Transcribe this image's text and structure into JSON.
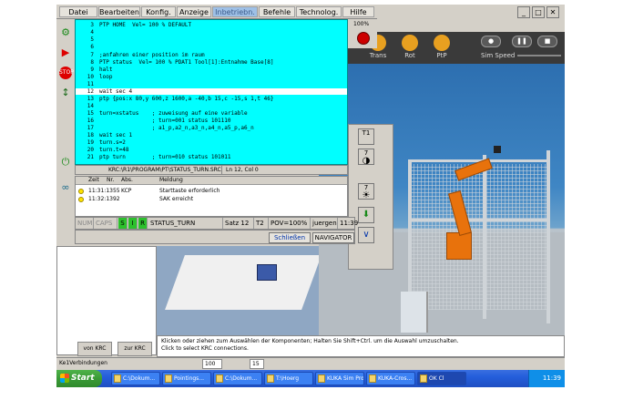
{
  "menu": [
    "Datei",
    "Bearbeiten",
    "Konfig.",
    "Anzeige",
    "Inbetriebn.",
    "Befehle",
    "Technolog.",
    "Hilfe"
  ],
  "window_controls": [
    "_",
    "□",
    "✕"
  ],
  "right_top": {
    "zoom": "100%"
  },
  "sim_toolbar": {
    "buttons": [
      "Trans",
      "Rot",
      "PtP"
    ],
    "speed_label": "Sim Speed"
  },
  "editor": {
    "lines": [
      {
        "num": "3",
        "code": "PTP HOME  Vel= 100 % DEFAULT"
      },
      {
        "num": "4",
        "code": ""
      },
      {
        "num": "5",
        "code": ""
      },
      {
        "num": "6",
        "code": ""
      },
      {
        "num": "7",
        "code": ";anfahren einer position im raum"
      },
      {
        "num": "8",
        "code": "PTP status  Vel= 100 % PDAT1 Tool[1]:Entnahme Base[8]"
      },
      {
        "num": "9",
        "code": "halt"
      },
      {
        "num": "10",
        "code": "loop"
      },
      {
        "num": "11",
        "code": ""
      },
      {
        "num": "12",
        "code": "wait sec 4"
      },
      {
        "num": "13",
        "code": "ptp {pos:x 80,y 600,z 1600,a -40,b 15,c -15,s 1,t 46}"
      },
      {
        "num": "14",
        "code": ""
      },
      {
        "num": "15",
        "code": "turn=xstatus    ; zuweisung auf eine variable"
      },
      {
        "num": "16",
        "code": "                ; turn=001 status 101110"
      },
      {
        "num": "17",
        "code": "                ; a1_p,a2_n,a3_n,a4_n,a5_p,a6_n"
      },
      {
        "num": "18",
        "code": "wait sec 1"
      },
      {
        "num": "19",
        "code": "turn.s=2"
      },
      {
        "num": "20",
        "code": "turn.t=48"
      },
      {
        "num": "21",
        "code": "ptp turn        ; turn=010 status 101011"
      }
    ],
    "path": "KRC:\\R1\\PROGRAM\\PT\\STATUS_TURN.SRC",
    "cursor_pos": "Ln 12, Col 0"
  },
  "messages": {
    "headers": [
      "Zeit",
      "Nr.",
      "Abs.",
      "Meldung"
    ],
    "rows": [
      {
        "time": "11:31:1355",
        "src": "KCP",
        "text": "Starttaste erforderlich"
      },
      {
        "time": "11:32:1392",
        "src": "",
        "text": "SAK erreicht"
      }
    ]
  },
  "status_line": {
    "num": "NUM",
    "caps": "CAPS",
    "s": "S",
    "i": "I",
    "r": "R",
    "program": "STATUS_TURN",
    "satz": "Satz 12",
    "t": "T2",
    "pov": "POV=100%",
    "user": "juergen",
    "time": "11:39"
  },
  "softkeys": {
    "close": "Schließen",
    "navigator": "NAVIGATOR"
  },
  "right_panel": {
    "b1": "T1",
    "b2": "7",
    "b3": "7"
  },
  "left_panel": {
    "btn1": "von KRC",
    "btn2": "zur KRC"
  },
  "message_bar": [
    "Klicken oder ziehen zum Auswählen der Komponenten; Halten Sie Shift+Ctrl. um die Auswahl umzuschalten.",
    "Click to select KRC connections."
  ],
  "app_status": {
    "label": "Ke1Verbindungen",
    "zoom": "100",
    "step": "15"
  },
  "taskbar": {
    "start": "Start",
    "tasks": [
      "C:\\Dokum...",
      "Pointings...",
      "C:\\Dokum...",
      "T:\\Hoerg",
      "KUKA Sim Pro",
      "KUKA-Cros...",
      "OK Cl"
    ],
    "clock": "11:39"
  }
}
